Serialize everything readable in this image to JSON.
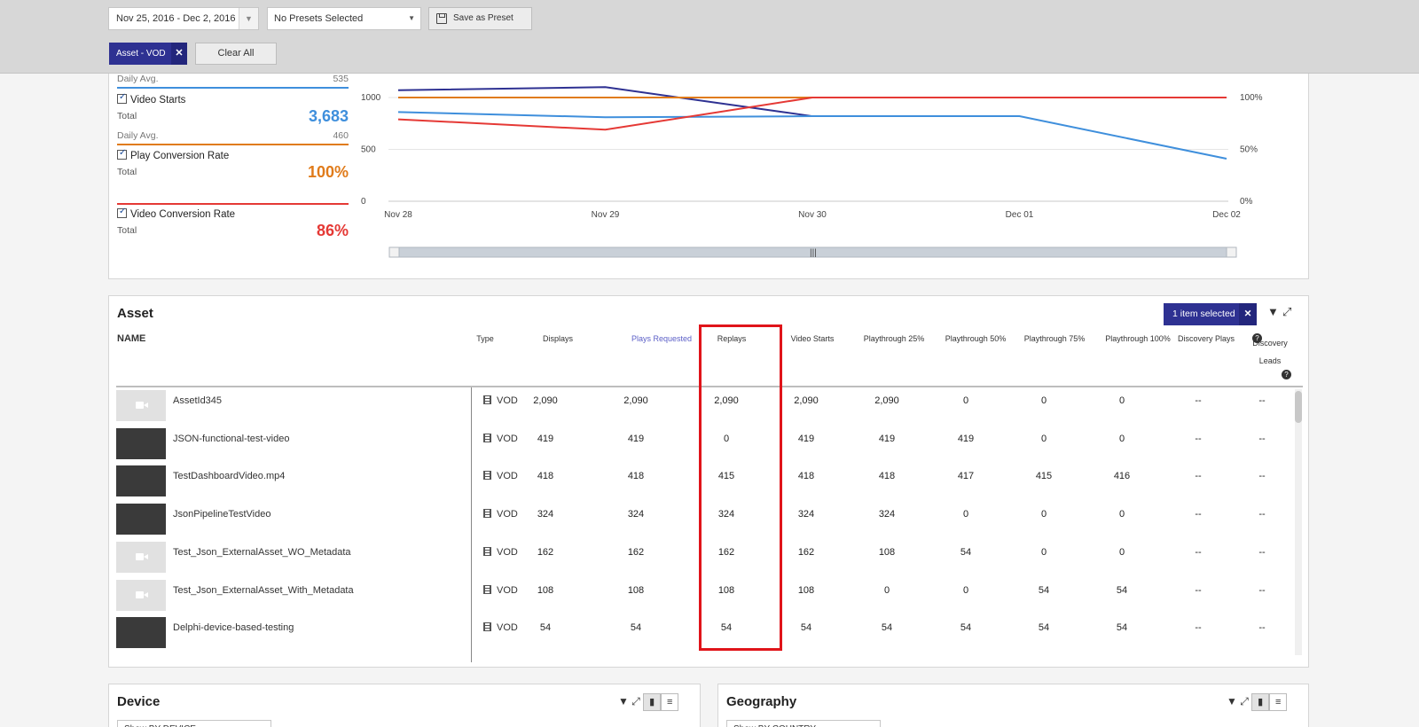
{
  "topbar": {
    "date_range": "Nov 25, 2016 - Dec 2, 2016",
    "preset": "No Presets Selected",
    "save_preset": "Save as Preset",
    "filter_chip": "Asset - VOD",
    "clear_all": "Clear All"
  },
  "metrics": {
    "top_daily_avg_label": "Daily Avg.",
    "top_daily_avg_value": "535",
    "video_starts": {
      "name": "Video Starts",
      "total_label": "Total",
      "total": "3,683",
      "daily_label": "Daily Avg.",
      "daily": "460",
      "color": "#3f8fdc"
    },
    "play_conversion": {
      "name": "Play Conversion Rate",
      "total_label": "Total",
      "total": "100%",
      "color": "#e07b1a"
    },
    "video_conversion": {
      "name": "Video Conversion Rate",
      "total_label": "Total",
      "total": "86%",
      "color": "#e53935"
    }
  },
  "chart_data": {
    "type": "line",
    "categories": [
      "Nov 28",
      "Nov 29",
      "Nov 30",
      "Dec 01",
      "Dec 02"
    ],
    "left_axis": {
      "ticks": [
        "0",
        "500",
        "1000"
      ]
    },
    "right_axis": {
      "ticks": [
        "0%",
        "50%",
        "100%"
      ]
    },
    "series": [
      {
        "color": "#2e3192",
        "values": [
          1070,
          1100,
          820,
          null,
          null
        ]
      },
      {
        "color": "#3f8fdc",
        "values": [
          860,
          810,
          820,
          820,
          410
        ]
      },
      {
        "color": "#e07b1a",
        "values": [
          1000,
          1000,
          1000,
          1000,
          1000
        ]
      },
      {
        "color": "#e53935",
        "values": [
          790,
          690,
          1000,
          1000,
          1000
        ]
      }
    ]
  },
  "asset": {
    "title": "Asset",
    "selected": "1 item selected",
    "name_header": "NAME",
    "columns": [
      "Type",
      "Displays",
      "Plays Requested",
      "Replays",
      "Video Starts",
      "Playthrough 25%",
      "Playthrough 50%",
      "Playthrough 75%",
      "Playthrough 100%",
      "Discovery Plays",
      "Discovery Leads"
    ],
    "rows": [
      {
        "name": "AssetId345",
        "type": "VOD",
        "values": [
          "2,090",
          "2,090",
          "2,090",
          "2,090",
          "2,090",
          "0",
          "0",
          "0",
          "--",
          "--"
        ]
      },
      {
        "name": "JSON-functional-test-video",
        "type": "VOD",
        "values": [
          "419",
          "419",
          "0",
          "419",
          "419",
          "419",
          "0",
          "0",
          "--",
          "--"
        ]
      },
      {
        "name": "TestDashboardVideo.mp4",
        "type": "VOD",
        "values": [
          "418",
          "418",
          "415",
          "418",
          "418",
          "417",
          "415",
          "416",
          "--",
          "--"
        ]
      },
      {
        "name": "JsonPipelineTestVideo",
        "type": "VOD",
        "values": [
          "324",
          "324",
          "324",
          "324",
          "324",
          "0",
          "0",
          "0",
          "--",
          "--"
        ]
      },
      {
        "name": "Test_Json_ExternalAsset_WO_Metadata",
        "type": "VOD",
        "values": [
          "162",
          "162",
          "162",
          "162",
          "108",
          "54",
          "0",
          "0",
          "--",
          "--"
        ]
      },
      {
        "name": "Test_Json_ExternalAsset_With_Metadata",
        "type": "VOD",
        "values": [
          "108",
          "108",
          "108",
          "108",
          "0",
          "0",
          "54",
          "54",
          "--",
          "--"
        ]
      },
      {
        "name": "Delphi-device-based-testing",
        "type": "VOD",
        "values": [
          "54",
          "54",
          "54",
          "54",
          "54",
          "54",
          "54",
          "54",
          "--",
          "--"
        ]
      }
    ]
  },
  "device": {
    "title": "Device",
    "select": "Show BY DEVICE"
  },
  "geography": {
    "title": "Geography",
    "select": "Show BY COUNTRY"
  }
}
